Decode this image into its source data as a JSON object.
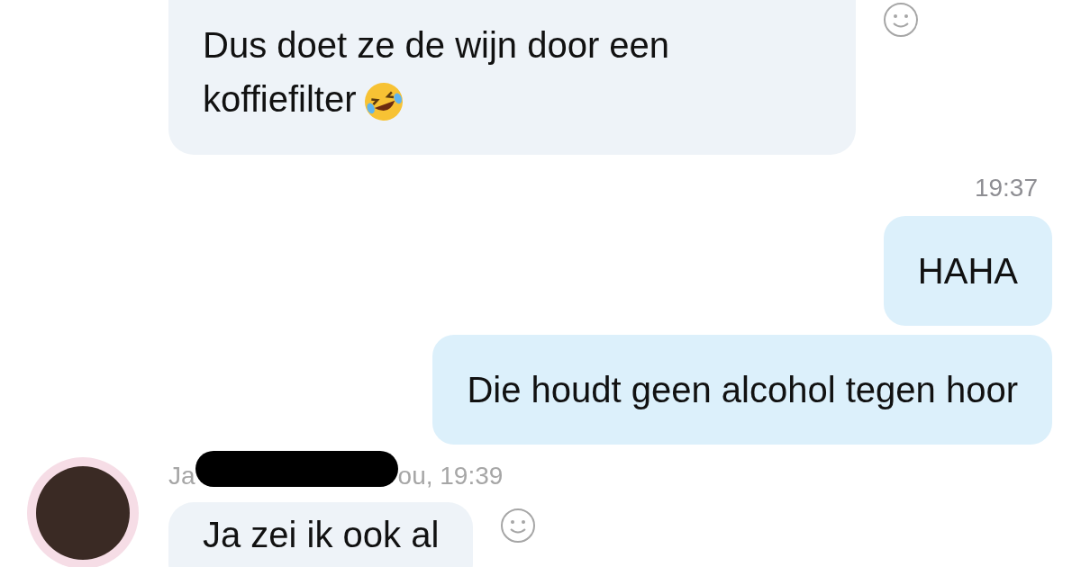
{
  "messages": [
    {
      "kind": "incoming",
      "text": "Dus doet ze de wijn door een koffiefilter",
      "emoji": true,
      "reaction_button": true
    },
    {
      "kind": "timestamp",
      "text": "19:37"
    },
    {
      "kind": "outgoing",
      "text": "HAHA"
    },
    {
      "kind": "outgoing",
      "text": "Die houdt geen alcohol tegen hoor"
    },
    {
      "kind": "sender",
      "name_start": "Ja",
      "name_end": "ou, 19:39",
      "redacted": true
    },
    {
      "kind": "incoming",
      "text": "Ja zei ik ook al",
      "reaction_button": true,
      "avatar": true
    }
  ]
}
